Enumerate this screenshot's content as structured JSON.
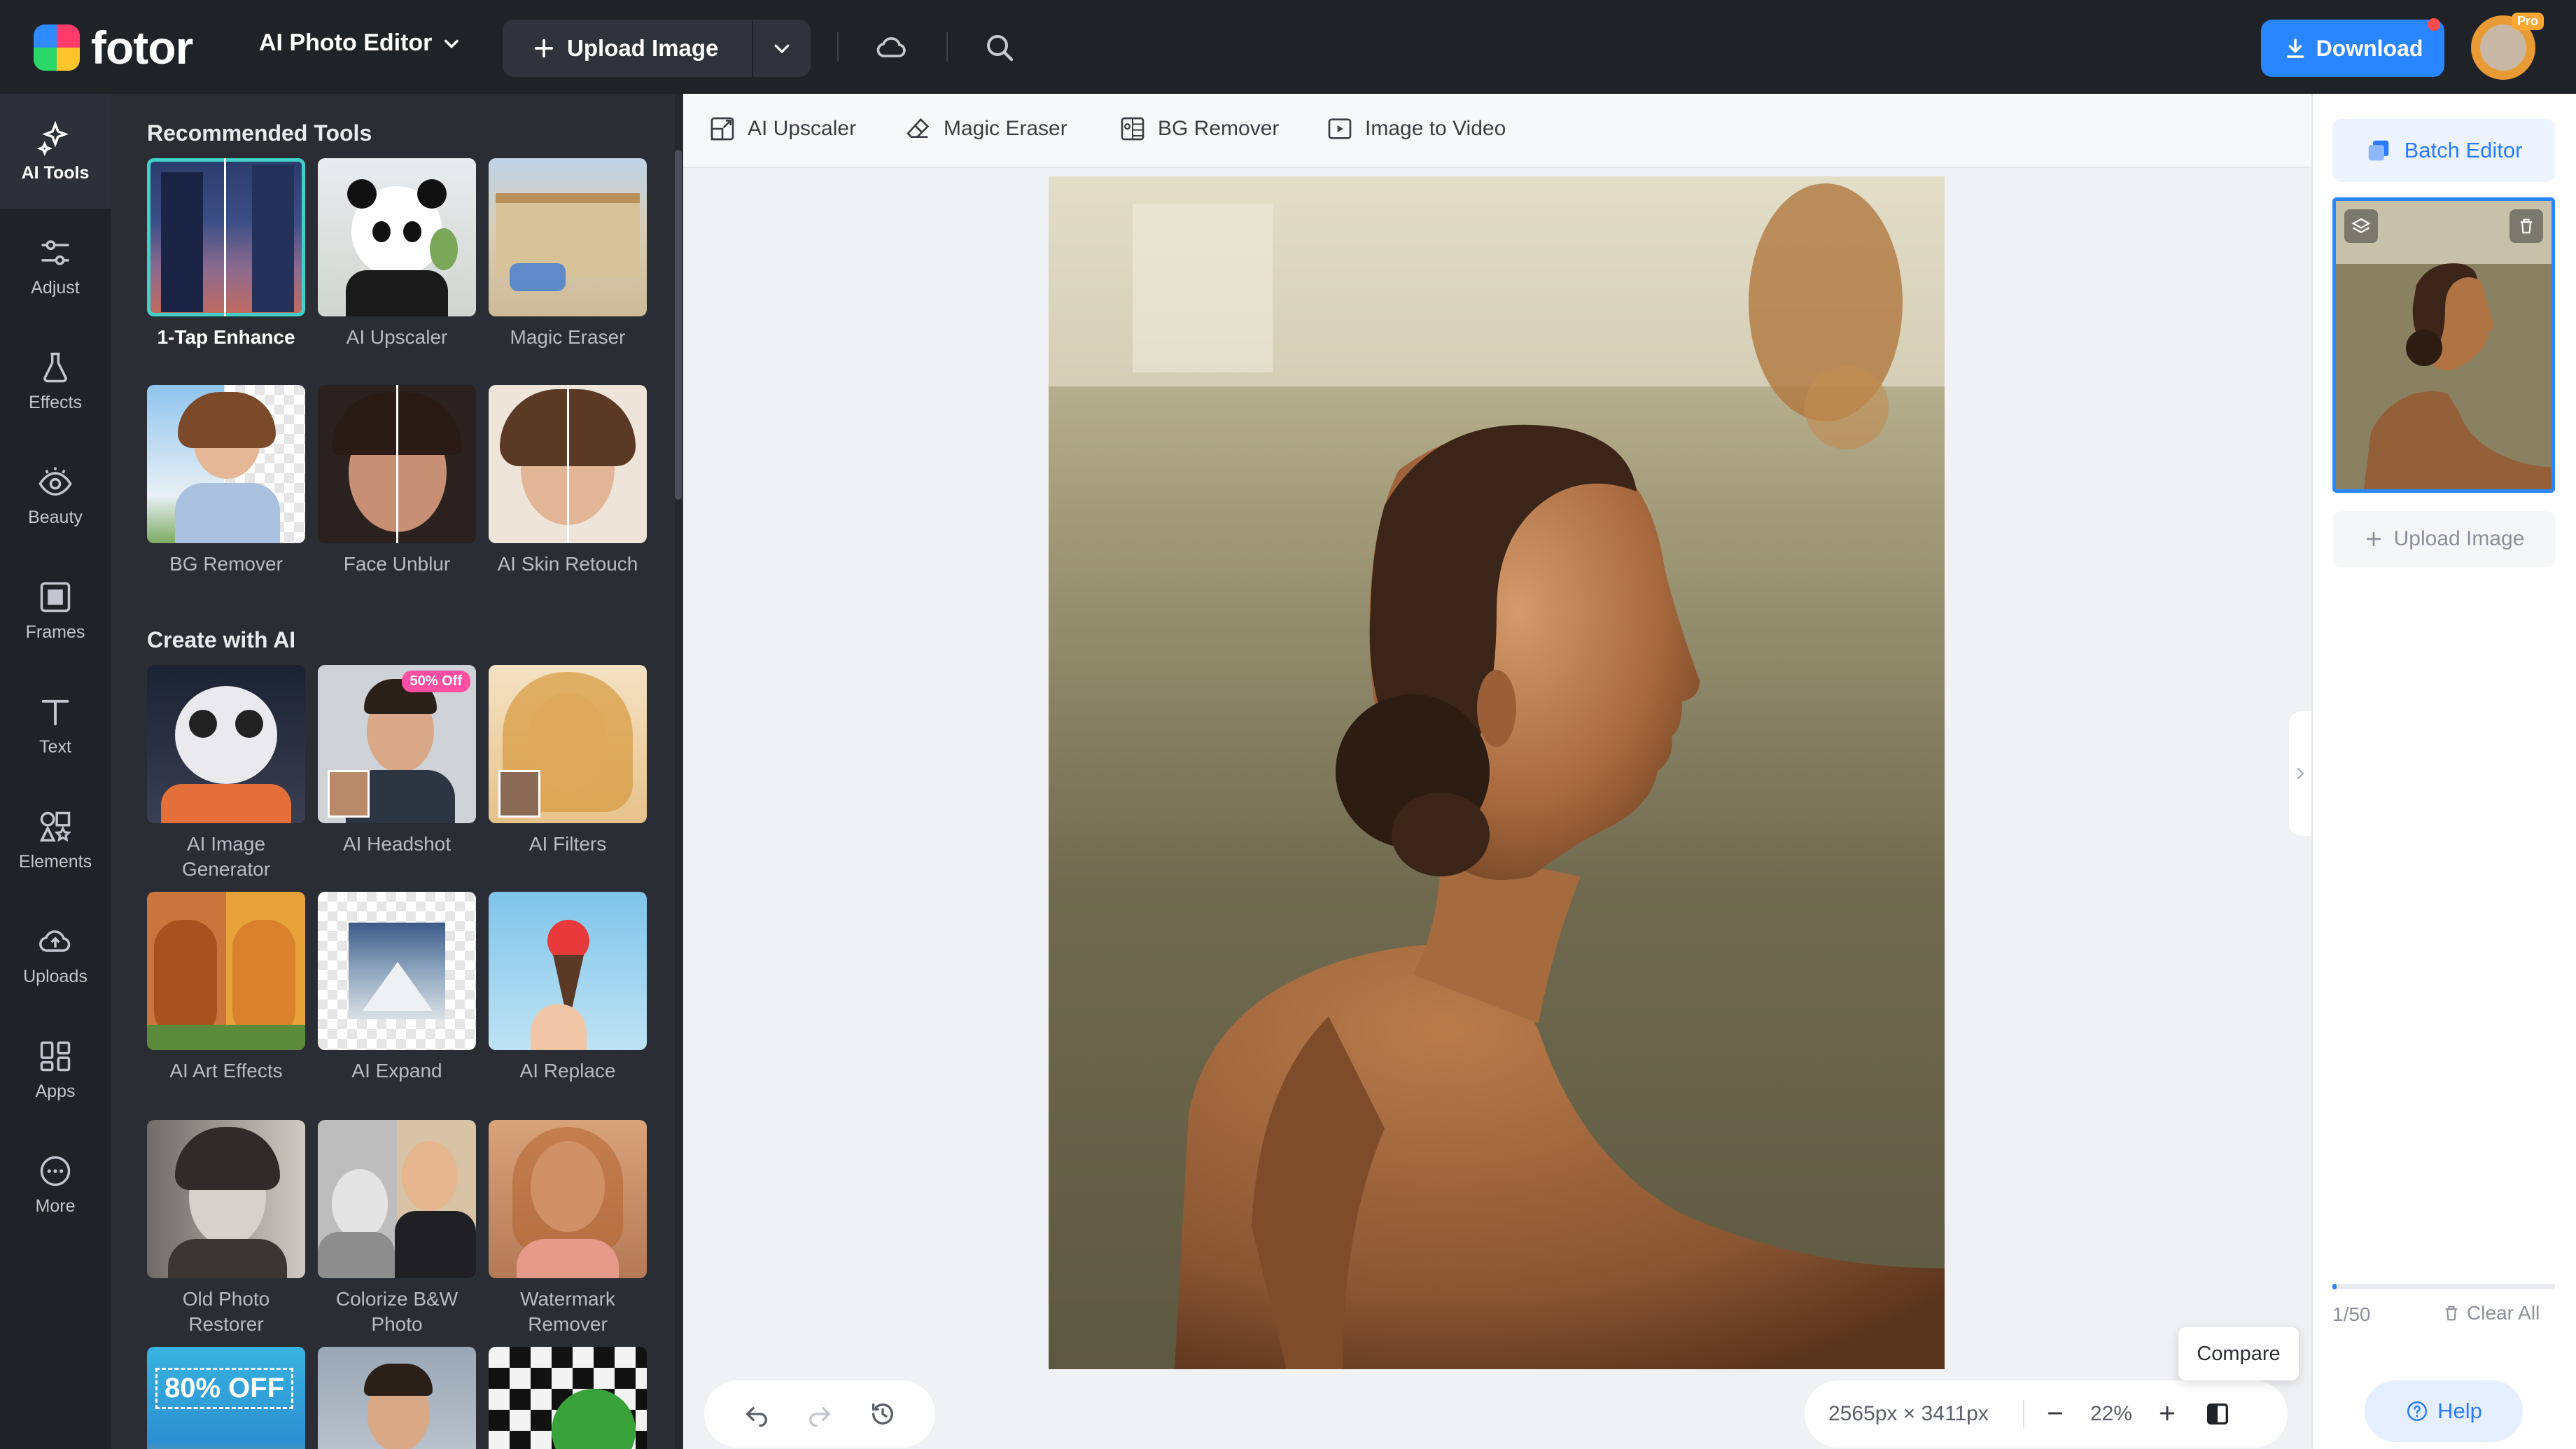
{
  "app": {
    "logo_text": "fotor",
    "editor_menu_label": "AI Photo Editor",
    "upload_label": "Upload Image",
    "download_label": "Download",
    "pro_badge": "Pro"
  },
  "nav": [
    {
      "label": "AI Tools",
      "icon": "sparkle-icon",
      "active": true
    },
    {
      "label": "Adjust",
      "icon": "sliders-icon"
    },
    {
      "label": "Effects",
      "icon": "flask-icon"
    },
    {
      "label": "Beauty",
      "icon": "eye-icon"
    },
    {
      "label": "Frames",
      "icon": "frame-icon"
    },
    {
      "label": "Text",
      "icon": "text-icon"
    },
    {
      "label": "Elements",
      "icon": "shapes-icon"
    },
    {
      "label": "Uploads",
      "icon": "cloud-upload-icon"
    },
    {
      "label": "Apps",
      "icon": "apps-icon"
    },
    {
      "label": "More",
      "icon": "more-icon"
    }
  ],
  "panel": {
    "recommended_title": "Recommended Tools",
    "create_title": "Create with AI",
    "recommended": [
      {
        "label": "1-Tap Enhance",
        "selected": true
      },
      {
        "label": "AI Upscaler"
      },
      {
        "label": "Magic Eraser"
      },
      {
        "label": "BG Remover"
      },
      {
        "label": "Face Unblur"
      },
      {
        "label": "AI Skin Retouch"
      }
    ],
    "create": [
      {
        "label": "AI Image Generator"
      },
      {
        "label": "AI Headshot",
        "badge": "50% Off"
      },
      {
        "label": "AI Filters"
      },
      {
        "label": "AI Art Effects"
      },
      {
        "label": "AI Expand"
      },
      {
        "label": "AI Replace"
      },
      {
        "label": "Old Photo Restorer"
      },
      {
        "label": "Colorize B&W Photo"
      },
      {
        "label": "Watermark Remover"
      }
    ],
    "promo_text": "80% OFF"
  },
  "toolbar": {
    "items": [
      {
        "label": "AI Upscaler",
        "icon": "upscale-icon"
      },
      {
        "label": "Magic Eraser",
        "icon": "eraser-icon"
      },
      {
        "label": "BG Remover",
        "icon": "bg-remove-icon"
      },
      {
        "label": "Image to Video",
        "icon": "video-icon"
      }
    ]
  },
  "canvas": {
    "dimensions": "2565px × 3411px",
    "zoom": "22%",
    "tooltip": "Compare"
  },
  "right_panel": {
    "batch_label": "Batch Editor",
    "upload_label": "Upload Image",
    "count": "1/50",
    "count_fraction": 0.02,
    "clear_label": "Clear All",
    "help_label": "Help"
  },
  "colors": {
    "accent": "#2a86ff",
    "selected_outline": "#3fd0c9",
    "dark_bg": "#1f2227",
    "panel_bg": "#2a2d33"
  }
}
